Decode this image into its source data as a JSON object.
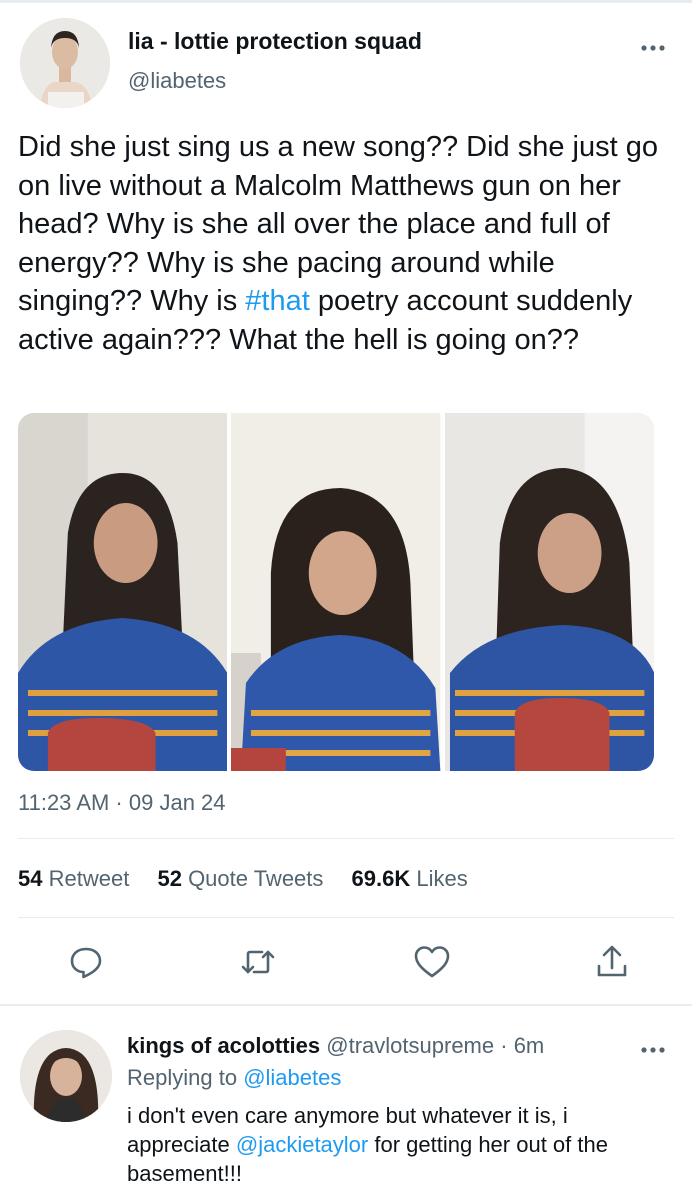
{
  "tweet": {
    "author_name": "lia - lottie protection squad",
    "author_handle": "@liabetes",
    "text_before_tag": "Did she just sing us a new song?? Did she just go on live without a Malcolm Matthews gun on her head? Why is she all over the place and full of energy?? Why is she pacing around while singing?? Why is ",
    "hashtag": "#that",
    "text_after_tag": " poetry account suddenly active again??? What the hell is going on??",
    "timestamp": "11:23 AM · 09 Jan 24",
    "stats": {
      "retweets_count": "54",
      "retweets_label": "Retweet",
      "quotes_count": "52",
      "quotes_label": "Quote Tweets",
      "likes_count": "69.6K",
      "likes_label": "Likes"
    },
    "media_count": 3
  },
  "actions": [
    "reply-icon",
    "retweet-icon",
    "like-icon",
    "share-icon"
  ],
  "reply": {
    "author_name": "kings of acolotties",
    "author_handle": "@travlotsupreme",
    "separator": " · ",
    "time": "6m",
    "replying_prefix": "Replying to ",
    "replying_handle": "@liabetes",
    "text_before_mention": "i don't even care anymore but whatever it is, i appreciate ",
    "mention": "@jackietaylor",
    "text_after_mention": " for getting her out of the basement!!!"
  },
  "colors": {
    "text_primary": "#0f1419",
    "text_secondary": "#536471",
    "accent": "#1d9bf0",
    "divider": "#e6ecf0"
  }
}
